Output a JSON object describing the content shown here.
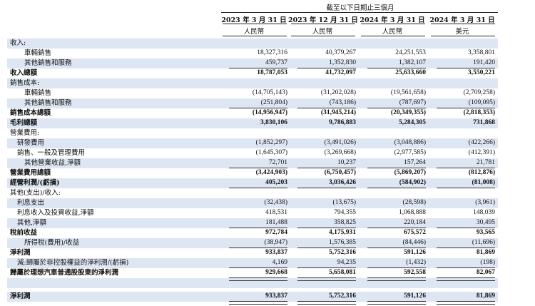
{
  "header": {
    "period_title": "截至以下日期止三個月",
    "columns": [
      {
        "date": "2023 年 3 月 31 日",
        "currency": "人民幣"
      },
      {
        "date": "2023 年 12 月 31 日",
        "currency": "人民幣"
      },
      {
        "date": "2024 年 3 月 31 日",
        "currency": "人民幣"
      },
      {
        "date": "2024 年 3 月 31 日",
        "currency": "美元"
      }
    ]
  },
  "rows": [
    {
      "label": "收入:",
      "values": [
        "",
        "",
        "",
        ""
      ],
      "bold": false,
      "indent": 0,
      "shade": true
    },
    {
      "label": "車輛銷售",
      "values": [
        "18,327,316",
        "40,379,267",
        "24,251,553",
        "3,358,801"
      ],
      "bold": false,
      "indent": 2,
      "shade": false
    },
    {
      "label": "其他銷售和服務",
      "values": [
        "459,737",
        "1,352,830",
        "1,382,107",
        "191,420"
      ],
      "bold": false,
      "indent": 2,
      "shade": true
    },
    {
      "label": "收入總額",
      "values": [
        "18,787,053",
        "41,732,097",
        "25,633,660",
        "3,550,221"
      ],
      "bold": true,
      "indent": 0,
      "shade": false
    },
    {
      "label": "銷售成本:",
      "values": [
        "",
        "",
        "",
        ""
      ],
      "bold": false,
      "indent": 0,
      "shade": true
    },
    {
      "label": "車輛銷售",
      "values": [
        "(14,705,143)",
        "(31,202,028)",
        "(19,561,658)",
        "(2,709,258)"
      ],
      "bold": false,
      "indent": 2,
      "shade": false
    },
    {
      "label": "其他銷售和服務",
      "values": [
        "(251,804)",
        "(743,186)",
        "(787,697)",
        "(109,095)"
      ],
      "bold": false,
      "indent": 2,
      "shade": true
    },
    {
      "label": "銷售成本總額",
      "values": [
        "(14,956,947)",
        "(31,945,214)",
        "(20,349,355)",
        "(2,818,353)"
      ],
      "bold": true,
      "indent": 0,
      "shade": false
    },
    {
      "label": "毛利總額",
      "values": [
        "3,830,106",
        "9,786,883",
        "5,284,305",
        "731,868"
      ],
      "bold": true,
      "indent": 0,
      "shade": true
    },
    {
      "label": "營業費用:",
      "values": [
        "",
        "",
        "",
        ""
      ],
      "bold": false,
      "indent": 0,
      "shade": false
    },
    {
      "label": "研發費用",
      "values": [
        "(1,852,297)",
        "(3,491,026)",
        "(3,048,886)",
        "(422,266)"
      ],
      "bold": false,
      "indent": 1,
      "shade": true
    },
    {
      "label": "銷售、一般及管理費用",
      "values": [
        "(1,645,307)",
        "(3,269,668)",
        "(2,977,585)",
        "(412,391)"
      ],
      "bold": false,
      "indent": 1,
      "shade": false
    },
    {
      "label": "其他營業收益,淨額",
      "values": [
        "72,701",
        "10,237",
        "157,264",
        "21,781"
      ],
      "bold": false,
      "indent": 2,
      "shade": true
    },
    {
      "label": "營業費用總額",
      "values": [
        "(3,424,903)",
        "(6,750,457)",
        "(5,869,207)",
        "(812,876)"
      ],
      "bold": true,
      "indent": 0,
      "shade": false
    },
    {
      "label": "經營利潤/(虧損)",
      "values": [
        "405,203",
        "3,036,426",
        "(584,902)",
        "(81,008)"
      ],
      "bold": true,
      "indent": 0,
      "shade": true
    },
    {
      "label": "其他(支出)/收入:",
      "values": [
        "",
        "",
        "",
        ""
      ],
      "bold": false,
      "indent": 0,
      "shade": false
    },
    {
      "label": "利息支出",
      "values": [
        "(32,438)",
        "(13,675)",
        "(28,598)",
        "(3,961)"
      ],
      "bold": false,
      "indent": 1,
      "shade": true
    },
    {
      "label": "利息收入及投資收益,淨額",
      "values": [
        "418,531",
        "794,355",
        "1,068,888",
        "148,039"
      ],
      "bold": false,
      "indent": 1,
      "shade": false
    },
    {
      "label": "其他,淨額",
      "values": [
        "181,488",
        "358,825",
        "220,184",
        "30,495"
      ],
      "bold": false,
      "indent": 1,
      "shade": true
    },
    {
      "label": "稅前收益",
      "values": [
        "972,784",
        "4,175,931",
        "675,572",
        "93,565"
      ],
      "bold": true,
      "indent": 0,
      "shade": false
    },
    {
      "label": "所得稅(費用)/收益",
      "values": [
        "(38,947)",
        "1,576,385",
        "(84,446)",
        "(11,696)"
      ],
      "bold": false,
      "indent": 2,
      "shade": true
    },
    {
      "label": "淨利潤",
      "values": [
        "933,837",
        "5,752,316",
        "591,126",
        "81,869"
      ],
      "bold": true,
      "indent": 0,
      "shade": false
    },
    {
      "label": "減:歸屬於非控股權益的淨利潤/(虧損)",
      "values": [
        "4,169",
        "94,235",
        "(1,432)",
        "(198)"
      ],
      "bold": false,
      "indent": 1,
      "shade": true
    },
    {
      "label": "歸屬於理想汽車普通股股東的淨利潤",
      "values": [
        "929,668",
        "5,658,081",
        "592,558",
        "82,067"
      ],
      "bold": true,
      "indent": 0,
      "shade": false
    },
    {
      "label": "",
      "values": [
        "",
        "",
        "",
        ""
      ],
      "bold": false,
      "indent": 0,
      "shade": true
    },
    {
      "label": "淨利潤",
      "values": [
        "933,837",
        "5,752,316",
        "591,126",
        "81,869"
      ],
      "bold": true,
      "indent": 0,
      "shade": true
    }
  ]
}
